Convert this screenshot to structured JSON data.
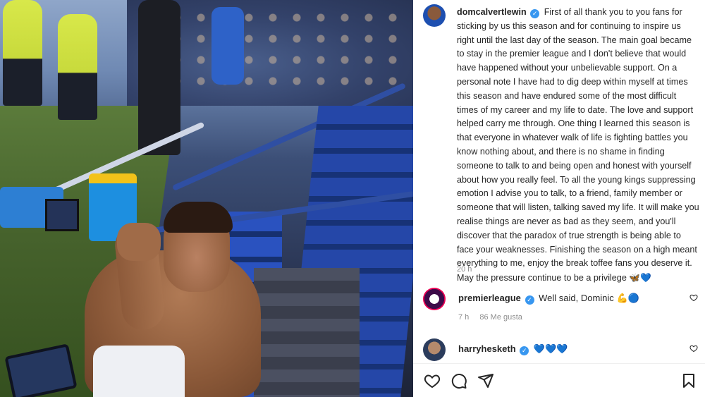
{
  "post": {
    "author": "domcalvertlewin",
    "caption": "First of all thank you to you fans for sticking by us this season and for continuing to inspire us right until the last day of the season. The main goal became to stay in the premier league and I don't believe that would have happened without your unbelievable support. On a personal note I have had to dig deep within myself at times this season and have endured some of the most difficult times of my career and my life to date. The love and support helped carry me through. One thing I learned this season is that everyone in whatever walk of life is fighting battles you know nothing about, and there is no shame in finding someone to talk to and being open and honest with yourself about how you really feel. To all the young kings suppressing emotion I advise you to talk, to a friend, family member or someone that will listen, talking saved my life. It will make you realise things are never as bad as they seem, and you'll discover that the paradox of true strength is being able to face your weaknesses. Finishing the season on a high meant everything to me, enjoy the break toffee fans you deserve it. May the pressure continue to be a privilege",
    "caption_emojis": "🦋💙",
    "time_ago": "20 h"
  },
  "comments": [
    {
      "username": "premierleague",
      "text": "Well said, Dominic",
      "emojis": "💪🔵",
      "time": "7 h",
      "likes": "86 Me gusta"
    },
    {
      "username": "harryhesketh",
      "text": "",
      "emojis": "💙💙💙"
    }
  ],
  "icons": {
    "verified": "verified-badge-icon",
    "like": "heart-icon",
    "comment": "comment-bubble-icon",
    "share": "paper-plane-icon",
    "save": "bookmark-icon"
  },
  "colors": {
    "verified": "#3897f0",
    "meta_text": "#8e8e8e",
    "text": "#262626",
    "heart_blue": "#1d72e8"
  }
}
